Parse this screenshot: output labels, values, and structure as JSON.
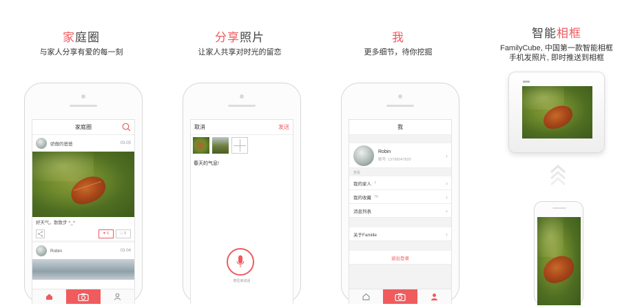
{
  "panels": [
    {
      "title_accent": "家",
      "title_rest": "庭圈",
      "subtitle": "与家人分享有爱的每一刻"
    },
    {
      "title_accent": "分享",
      "title_rest": "照片",
      "subtitle": "让家人共享对时光的留恋"
    },
    {
      "title_accent": "我",
      "title_rest": "",
      "subtitle": "更多细节，待你挖掘"
    },
    {
      "title_accent": "相框",
      "title_prefix": "智能",
      "subtitle_line1": "FamilyCube, 中国第一款智能相框",
      "subtitle_line2": "手机发照片, 即时推送到相框"
    }
  ],
  "feed": {
    "nav_title": "家庭圈",
    "post1_user": "骄傲的爸爸",
    "post1_date": "03-05",
    "post1_caption": "好天气，散散步 ^_^",
    "like_count": "6",
    "comment_count": "0",
    "post2_user": "Robin",
    "post2_date": "03-04"
  },
  "share": {
    "cancel": "取消",
    "send": "发送",
    "text": "春天的气息!",
    "voice_hint": "按住来说话"
  },
  "me": {
    "nav_title": "我",
    "name": "Robin",
    "account": "账号: 13798047820",
    "section": "查看",
    "items": [
      {
        "label": "我的家人",
        "count": "7"
      },
      {
        "label": "我的收藏",
        "count": "76"
      },
      {
        "label": "消息列表",
        "count": ""
      }
    ],
    "about": "关于Famille",
    "logout": "退出登录"
  },
  "colors": {
    "accent": "#ef5a5e"
  }
}
